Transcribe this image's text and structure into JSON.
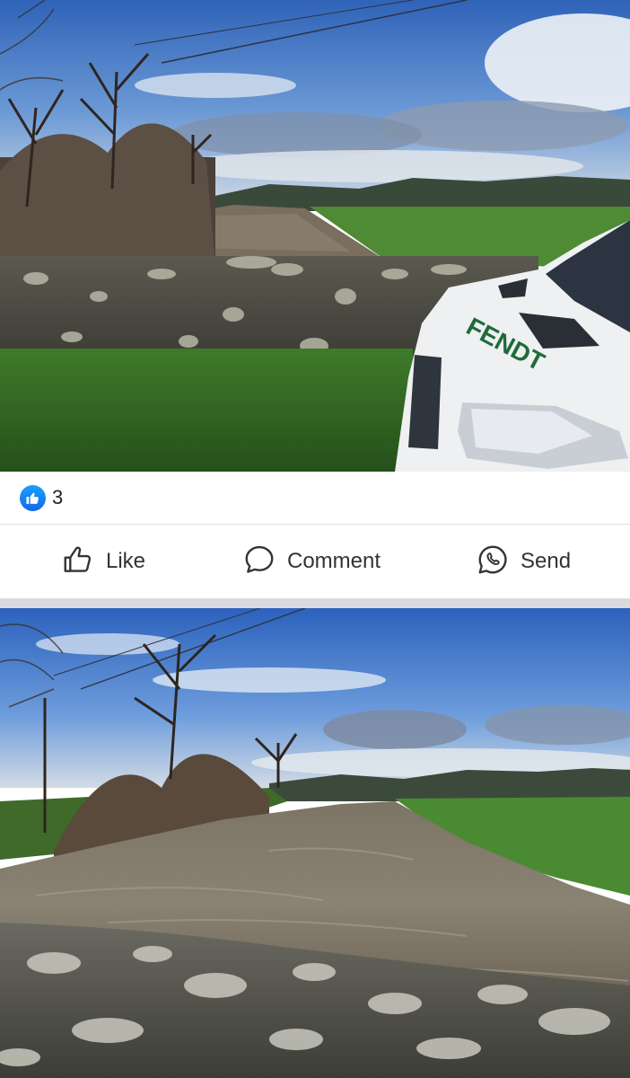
{
  "post": {
    "image_1": {
      "alt": "Flooded river beside an old stone bridge wall with a white van parked alongside",
      "van_lettering": "FENDT"
    },
    "reactions": {
      "icon": "like-thumb-icon",
      "count": "3"
    },
    "actions": [
      {
        "label": "Like",
        "icon": "thumbs-up-icon"
      },
      {
        "label": "Comment",
        "icon": "speech-bubble-icon"
      },
      {
        "label": "Send",
        "icon": "whatsapp-icon"
      }
    ],
    "image_2": {
      "alt": "Swollen brown river flowing between fields under a blue sky, viewed over a lichen-covered stone parapet"
    }
  },
  "colors": {
    "reaction_blue": "#1877f2",
    "icon_gray": "#333333",
    "separator": "#d9dadd"
  }
}
